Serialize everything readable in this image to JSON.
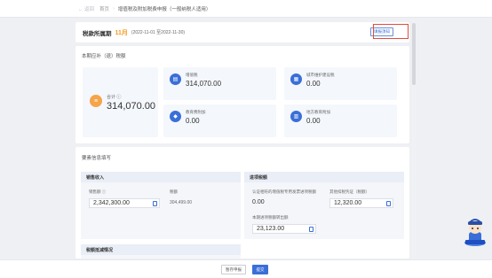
{
  "breadcrumb": {
    "back": "返回",
    "home": "首页",
    "current": "增值税及附加税费申报（一般纳税人适用）"
  },
  "period": {
    "label": "税款所属期",
    "month": "11月",
    "range": "(2022-11-01 至2022-11-30)",
    "button": "填报须知"
  },
  "tax_section": {
    "title": "本期应补（退）税额",
    "total": {
      "label": "合计",
      "value": "314,070.00"
    },
    "items": [
      {
        "icon": "vat-icon",
        "label": "增值税",
        "value": "314,070.00"
      },
      {
        "icon": "city-tax-icon",
        "label": "城市维护建设税",
        "value": "0.00"
      },
      {
        "icon": "education-icon",
        "label": "教育费附加",
        "value": "0.00"
      },
      {
        "icon": "local-education-icon",
        "label": "地方教育附加",
        "value": "0.00"
      }
    ]
  },
  "base_section": {
    "title": "要素信息填写",
    "sales": {
      "title": "销售收入",
      "field1_label": "销售额",
      "field1_value": "2,342,300.00",
      "field2_label": "税额",
      "field2_value": "304,499.00"
    },
    "input": {
      "title": "进项税额",
      "field1_label": "认证相符的增值税专用发票进项税额",
      "field1_value": "0.00",
      "field2_label": "其他扣税凭证（税额）",
      "field2_value": "12,320.00",
      "field3_label": "本期进项税额转出额",
      "field3_value": "23,123.00"
    },
    "reduction": {
      "title": "税额抵减情况"
    }
  },
  "bottom": {
    "save": "暂存申报",
    "submit": "提交"
  },
  "colors": {
    "accent": "#3a6fd8",
    "orange": "#f5a44a",
    "highlight": "#e34b3c"
  }
}
